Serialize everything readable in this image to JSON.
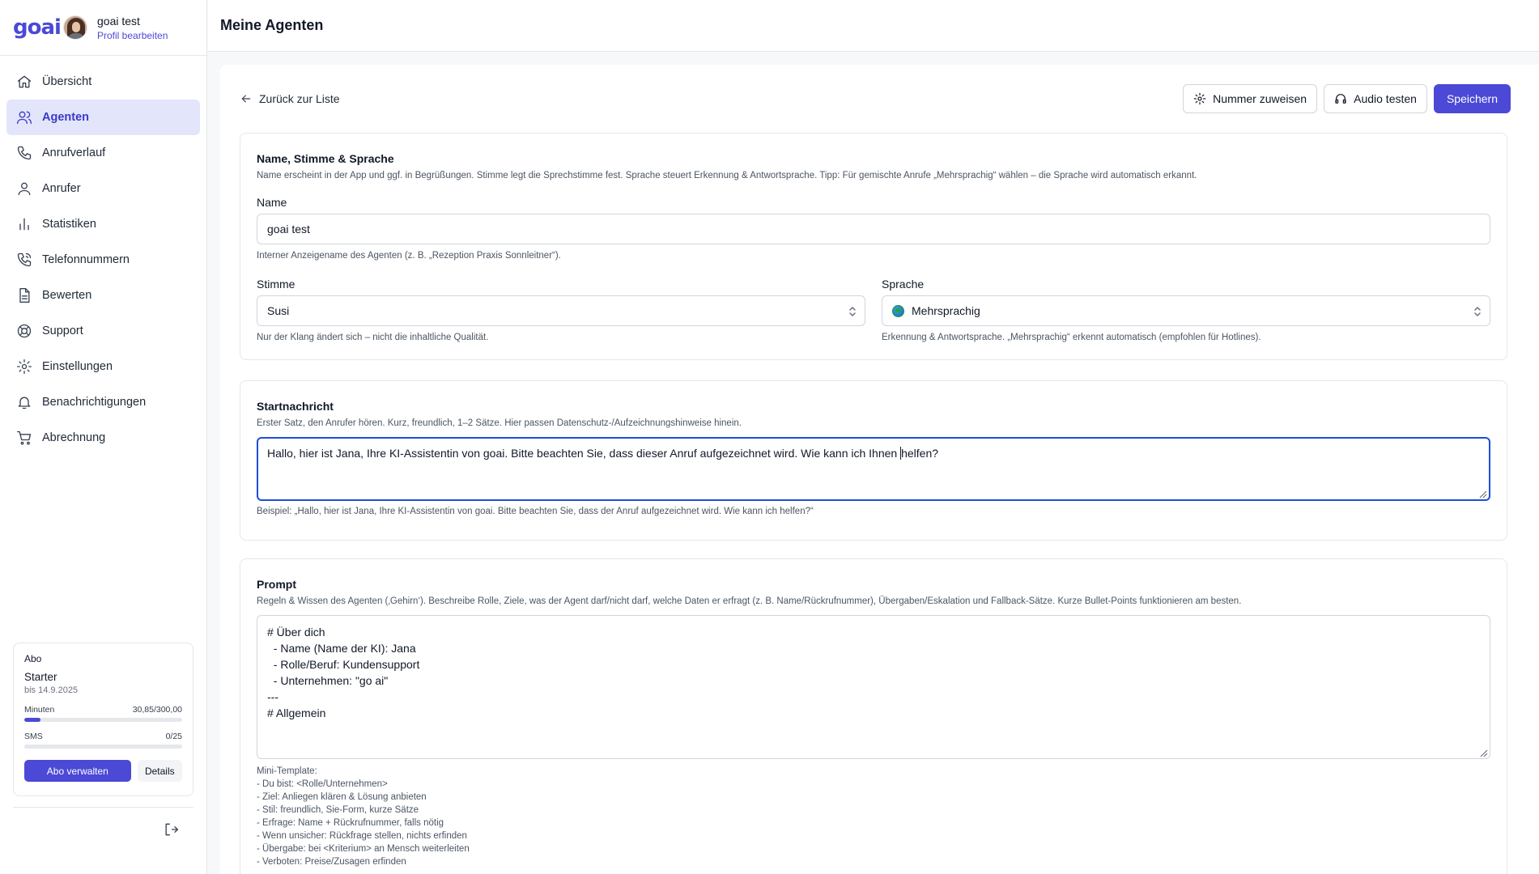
{
  "brand": {
    "logo_text": "goai",
    "accent": "#4b49d6"
  },
  "user": {
    "name": "goai test",
    "edit_link": "Profil bearbeiten"
  },
  "sidebar": {
    "items": [
      {
        "label": "Übersicht",
        "icon": "home-icon",
        "active": false
      },
      {
        "label": "Agenten",
        "icon": "users-icon",
        "active": true
      },
      {
        "label": "Anrufverlauf",
        "icon": "phone-icon",
        "active": false
      },
      {
        "label": "Anrufer",
        "icon": "user-icon",
        "active": false
      },
      {
        "label": "Statistiken",
        "icon": "bar-chart-icon",
        "active": false
      },
      {
        "label": "Telefonnummern",
        "icon": "phone-call-icon",
        "active": false
      },
      {
        "label": "Bewerten",
        "icon": "file-text-icon",
        "active": false
      },
      {
        "label": "Support",
        "icon": "life-buoy-icon",
        "active": false
      },
      {
        "label": "Einstellungen",
        "icon": "gear-icon",
        "active": false
      },
      {
        "label": "Benachrichtigungen",
        "icon": "bell-icon",
        "active": false
      },
      {
        "label": "Abrechnung",
        "icon": "cart-icon",
        "active": false
      }
    ]
  },
  "subscription": {
    "title": "Abo",
    "plan": "Starter",
    "until": "bis 14.9.2025",
    "minutes_label": "Minuten",
    "minutes_value": "30,85/300,00",
    "minutes_fraction": 0.1028,
    "sms_label": "SMS",
    "sms_value": "0/25",
    "sms_fraction": 0,
    "manage_button": "Abo verwalten",
    "details_button": "Details"
  },
  "header": {
    "title": "Meine Agenten"
  },
  "toolbar": {
    "back_label": "Zurück zur Liste",
    "assign_number": "Nummer zuweisen",
    "test_audio": "Audio testen",
    "save": "Speichern"
  },
  "section_voice": {
    "title": "Name, Stimme & Sprache",
    "description": "Name erscheint in der App und ggf. in Begrüßungen. Stimme legt die Sprechstimme fest. Sprache steuert Erkennung & Antwortsprache. Tipp: Für gemischte Anrufe „Mehrsprachig“ wählen – die Sprache wird automatisch erkannt.",
    "name_label": "Name",
    "name_value": "goai test",
    "name_hint": "Interner Anzeigename des Agenten (z. B. „Rezeption Praxis Sonnleitner“).",
    "voice_label": "Stimme",
    "voice_value": "Susi",
    "voice_hint": "Nur der Klang ändert sich – nicht die inhaltliche Qualität.",
    "language_label": "Sprache",
    "language_value": "Mehrsprachig",
    "language_hint": "Erkennung & Antwortsprache. „Mehrsprachig“ erkennt automatisch (empfohlen für Hotlines)."
  },
  "section_start": {
    "title": "Startnachricht",
    "description": "Erster Satz, den Anrufer hören. Kurz, freundlich, 1–2 Sätze. Hier passen Datenschutz-/Aufzeichnungshinweise hinein.",
    "value_before_caret": "Hallo, hier ist Jana, Ihre KI-Assistentin von goai. Bitte beachten Sie, dass dieser Anruf aufgezeichnet wird. Wie kann ich Ihnen ",
    "value_after_caret": "helfen?",
    "example": "Beispiel: „Hallo, hier ist Jana, Ihre KI-Assistentin von goai. Bitte beachten Sie, dass der Anruf aufgezeichnet wird. Wie kann ich helfen?“"
  },
  "section_prompt": {
    "title": "Prompt",
    "description": "Regeln & Wissen des Agenten (‚Gehirn‘). Beschreibe Rolle, Ziele, was der Agent darf/nicht darf, welche Daten er erfragt (z. B. Name/Rückrufnummer), Übergaben/Eskalation und Fallback-Sätze. Kurze Bullet-Points funktionieren am besten.",
    "lines": [
      "# Über dich",
      "  - Name (Name der KI): Jana",
      "  - Rolle/Beruf: Kundensupport",
      "  - Unternehmen: \"go ai\"",
      "---",
      "# Allgemein"
    ],
    "mini_template": [
      "Mini-Template:",
      "- Du bist: <Rolle/Unternehmen>",
      "- Ziel: Anliegen klären & Lösung anbieten",
      "- Stil: freundlich, Sie-Form, kurze Sätze",
      "- Erfrage: Name + Rückrufnummer, falls nötig",
      "- Wenn unsicher: Rückfrage stellen, nichts erfinden",
      "- Übergabe: bei <Kriterium> an Mensch weiterleiten",
      "- Verboten: Preise/Zusagen erfinden"
    ]
  }
}
